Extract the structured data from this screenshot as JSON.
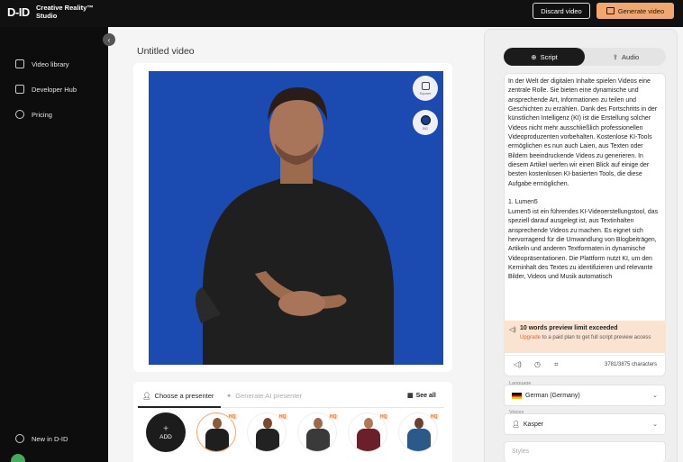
{
  "topbar": {
    "logo": "D-ID",
    "brand_line1": "Creative Reality™",
    "brand_line2": "Studio",
    "discard_label": "Discard video",
    "generate_label": "Generate video"
  },
  "sidebar": {
    "items": [
      {
        "label": "Video library",
        "icon": "video-library-icon"
      },
      {
        "label": "Developer Hub",
        "icon": "developer-hub-icon"
      },
      {
        "label": "Pricing",
        "icon": "pricing-icon"
      }
    ],
    "new_label": "New in D-ID"
  },
  "main": {
    "title": "Untitled video",
    "controls": {
      "square_label": "Square",
      "bg_label": "BG"
    },
    "presenter_tabs": {
      "choose": "Choose a presenter",
      "generate": "Generate AI presenter",
      "see_all": "See all"
    },
    "add_label": "ADD",
    "hq_badge": "HQ"
  },
  "right": {
    "tabs": {
      "script": "Script",
      "audio": "Audio"
    },
    "script_text": "In der Welt der digitalen Inhalte spielen Videos eine zentrale Rolle. Sie bieten eine dynamische und ansprechende Art, Informationen zu teilen und Geschichten zu erzählen. Dank des Fortschritts in der künstlichen Intelligenz (KI) ist die Erstellung solcher Videos nicht mehr ausschließlich professionellen Videoproduzenten vorbehalten. Kostenlose KI-Tools ermöglichen es nun auch Laien, aus Texten oder Bildern beeindruckende Videos zu generieren. In diesem Artikel werfen wir einen Blick auf einige der besten kostenlosen KI-basierten Tools, die diese Aufgabe ermöglichen.\n\n1. Lumen5\nLumen5 ist ein führendes KI-Videoerstellungstool, das speziell darauf ausgelegt ist, aus Textinhalten ansprechende Videos zu machen. Es eignet sich hervorragend für die Umwandlung von Blogbeiträgen, Artikeln und anderen Textformaten in dynamische Videopräsentationen. Die Plattform nutzt KI, um den Kerninhalt des Textes zu identifizieren und relevante Bilder, Videos und Musik automatisch",
    "limit_title": "10 words preview limit exceeded",
    "limit_upgrade": "Upgrade",
    "limit_rest": " to a paid plan to get full script preview access",
    "char_count": "3781/3875 characters",
    "language_label": "Language",
    "language_value": "German (Germany)",
    "voices_label": "Voices",
    "voice_value": "Kasper",
    "styles_placeholder": "Styles"
  },
  "colors": {
    "accent": "#f0a870",
    "canvas_bg": "#1b4bb0",
    "sidebar_bg": "#0d0d0d"
  }
}
